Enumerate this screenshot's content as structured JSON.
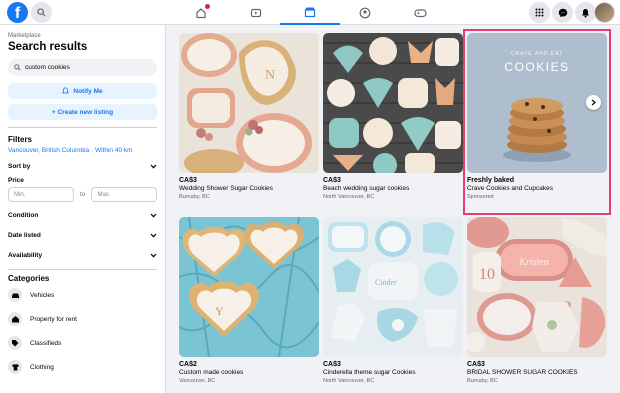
{
  "topbar": {
    "logo": "f",
    "nav": [
      "home-icon",
      "watch-icon",
      "marketplace-icon",
      "groups-icon",
      "gaming-icon"
    ],
    "active_nav": "marketplace-icon",
    "right": [
      "menu-grid-icon",
      "messenger-icon",
      "notifications-icon"
    ]
  },
  "sidebar": {
    "crumb": "Marketplace",
    "title": "Search results",
    "search_value": "custom cookies",
    "notify_label": "Notify Me",
    "create_label": "+ Create new listing",
    "filters_title": "Filters",
    "location": "Vancouver, British Columbia · Within 40 km",
    "sort_label": "Sort by",
    "price_label": "Price",
    "min_placeholder": "Min.",
    "to_label": "to",
    "max_placeholder": "Max.",
    "condition_label": "Condition",
    "date_label": "Date listed",
    "availability_label": "Availability",
    "categories_title": "Categories",
    "categories": [
      {
        "label": "Vehicles",
        "icon": "car-icon"
      },
      {
        "label": "Property for rent",
        "icon": "house-icon"
      },
      {
        "label": "Classifieds",
        "icon": "tag-icon"
      },
      {
        "label": "Clothing",
        "icon": "shirt-icon"
      }
    ]
  },
  "listings": [
    {
      "price": "CA$3",
      "title": "Wedding Shower Sugar Cookies",
      "location": "Burnaby, BC"
    },
    {
      "price": "CA$3",
      "title": "Beach wedding sugar cookies",
      "location": "North Vancouver, BC"
    },
    {
      "price": "Freshly baked",
      "title": "Crave Cookies and Cupcakes",
      "location": "Sponsored",
      "ad_small": "CRAVE AND EAT",
      "ad_big": "COOKIES"
    },
    {
      "price": "CA$2",
      "title": "Custom made cookies",
      "location": "Vancouver, BC"
    },
    {
      "price": "CA$3",
      "title": "Cinderella theme sugar Cookies",
      "location": "North Vancouver, BC"
    },
    {
      "price": "CA$3",
      "title": "BRIDAL SHOWER SUGAR COOKIES",
      "location": "Burnaby, BC",
      "cookie_text": "Kristen"
    }
  ],
  "colors": {
    "accent": "#1877f2",
    "sponsored_outline": "#e4406f",
    "notification_dot": "#e41e3f"
  }
}
